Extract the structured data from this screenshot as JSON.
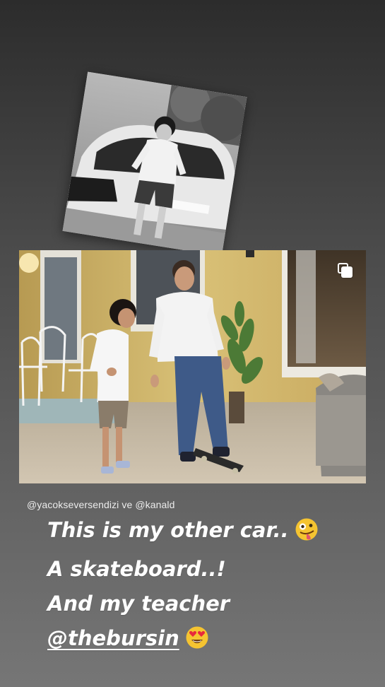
{
  "story": {
    "background_colors": [
      "#2c2c2c",
      "#767676"
    ],
    "photo_top": {
      "description_icon": "bw-photo-boy-with-car"
    },
    "photo_main": {
      "description_icon": "photo-man-teaching-boy-skateboard",
      "multi_photo_icon": "multi-photo-icon"
    },
    "credit": {
      "text": "@yacokseversendizi ve @kanald"
    },
    "caption": {
      "line1": "This is my other car..",
      "line1_emoji": "zany-face-emoji",
      "line2": "A skateboard..!",
      "line3": "And my teacher",
      "mention": "@thebursin",
      "line4_emoji": "heart-eyes-emoji"
    }
  }
}
